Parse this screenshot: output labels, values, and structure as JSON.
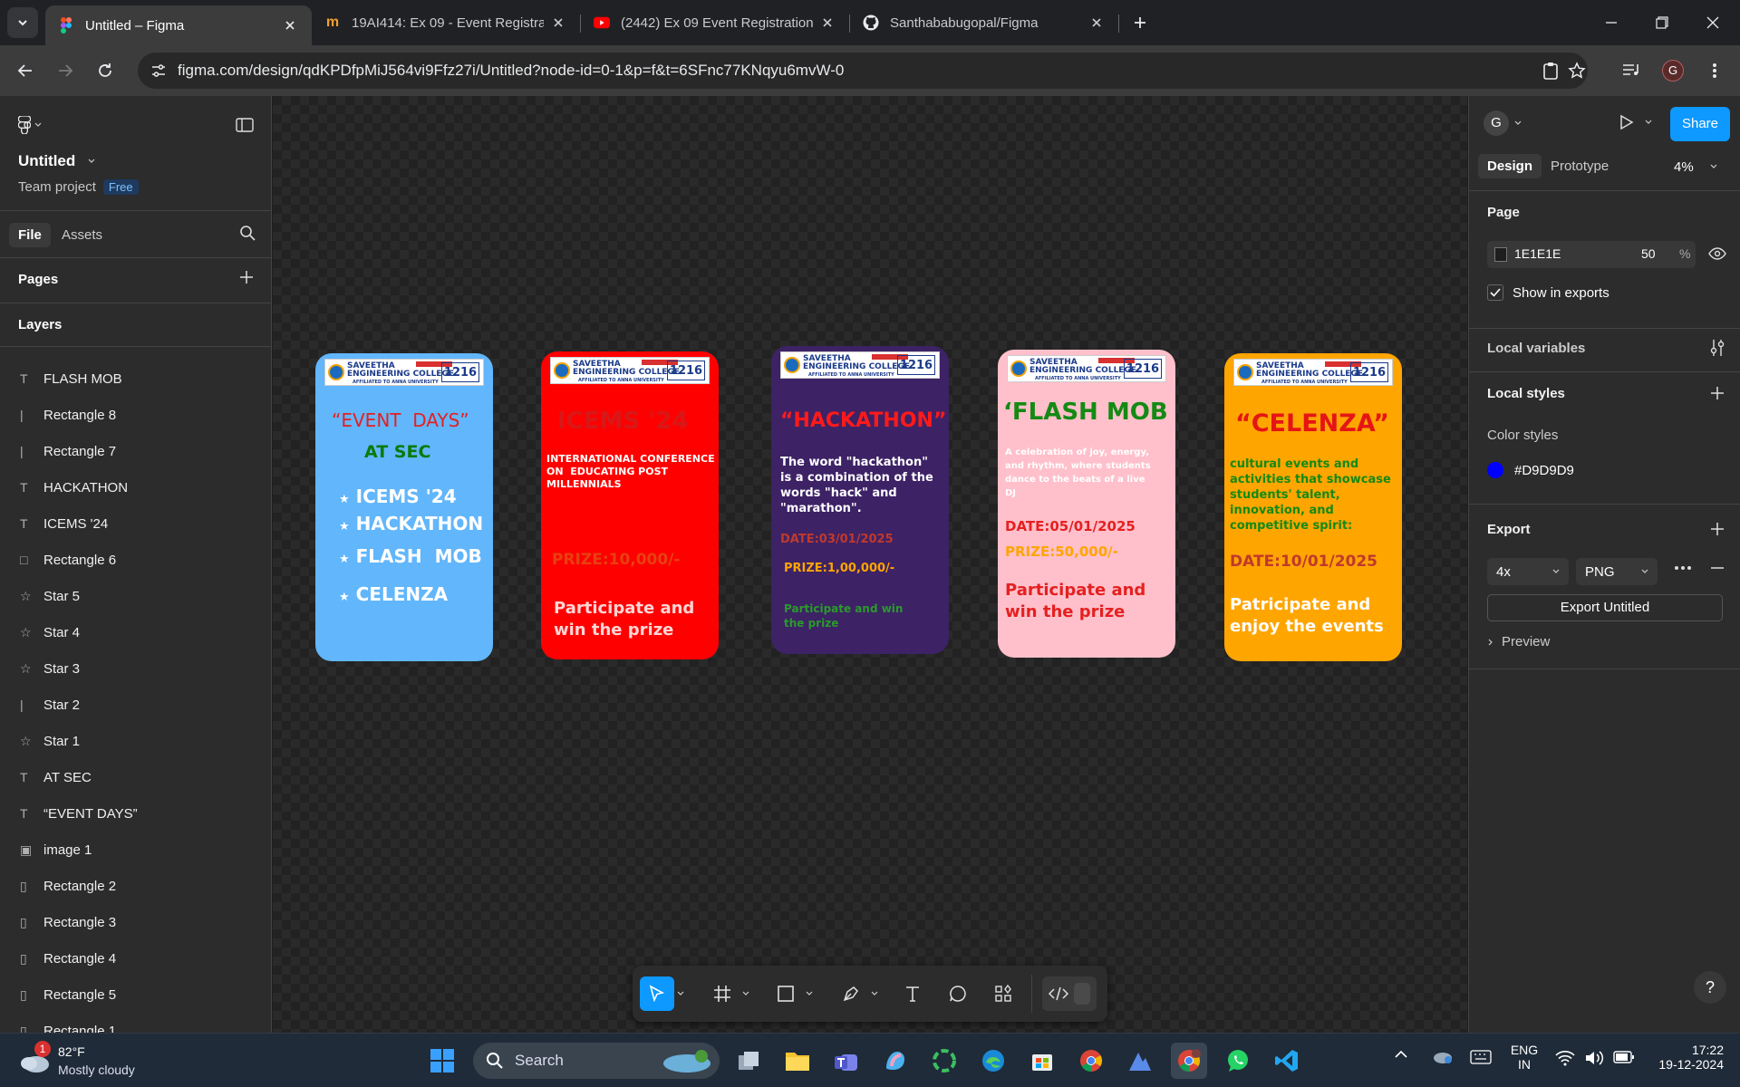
{
  "browser": {
    "tabs": [
      {
        "title": "Untitled – Figma",
        "active": true
      },
      {
        "title": "19AI414: Ex 09 - Event Registrat",
        "active": false
      },
      {
        "title": "(2442) Ex 09 Event Registration",
        "active": false
      },
      {
        "title": "Santhababugopal/Figma",
        "active": false
      }
    ],
    "url": "figma.com/design/qdKPDfpMiJ564vi9Ffz27i/Untitled?node-id=0-1&p=f&t=6SFnc77KNqyu6mvW-0",
    "profile_initial": "G"
  },
  "left_panel": {
    "file_name": "Untitled",
    "team_label": "Team project",
    "plan_badge": "Free",
    "tabs": {
      "file": "File",
      "assets": "Assets"
    },
    "pages_label": "Pages",
    "layers_label": "Layers",
    "layers": [
      {
        "icon": "T",
        "name": "FLASH MOB"
      },
      {
        "icon": "|",
        "name": "Rectangle 8"
      },
      {
        "icon": "|",
        "name": "Rectangle 7"
      },
      {
        "icon": "T",
        "name": "HACKATHON"
      },
      {
        "icon": "T",
        "name": "ICEMS '24"
      },
      {
        "icon": "□",
        "name": "Rectangle 6"
      },
      {
        "icon": "☆",
        "name": "Star 5"
      },
      {
        "icon": "☆",
        "name": "Star 4"
      },
      {
        "icon": "☆",
        "name": "Star 3"
      },
      {
        "icon": "|",
        "name": "Star 2"
      },
      {
        "icon": "☆",
        "name": "Star 1"
      },
      {
        "icon": "T",
        "name": "AT SEC"
      },
      {
        "icon": "T",
        "name": "“EVENT DAYS”"
      },
      {
        "icon": "▣",
        "name": "image 1"
      },
      {
        "icon": "▯",
        "name": "Rectangle 2"
      },
      {
        "icon": "▯",
        "name": "Rectangle 3"
      },
      {
        "icon": "▯",
        "name": "Rectangle 4"
      },
      {
        "icon": "▯",
        "name": "Rectangle 5"
      },
      {
        "icon": "▯",
        "name": "Rectangle 1"
      }
    ]
  },
  "logo": {
    "name": "SAVEETHA\nENGINEERING COLLEGE",
    "affiliation": "AFFILIATED TO ANNA UNIVERSITY",
    "code": "1216"
  },
  "cards": {
    "c1": {
      "title": "“EVENT  DAYS”",
      "subtitle": "AT SEC",
      "items": [
        "ICEMS '24",
        "HACKATHON",
        "FLASH  MOB",
        "CELENZA"
      ]
    },
    "c2": {
      "title": "ICEMS '24",
      "body": "INTERNATIONAL CONFERENCE\nON  EDUCATING POST\nMILLENNIALS",
      "prize": "PRIZE:10,000/-",
      "cta": "Participate and\nwin the prize"
    },
    "c3": {
      "title": "“HACKATHON”",
      "body": "The word \"hackathon\"\nis a combination of the\nwords \"hack\" and\n\"marathon\".",
      "date": "DATE:03/01/2025",
      "prize": "PRIZE:1,00,000/-",
      "cta": "Participate and win\nthe prize"
    },
    "c4": {
      "title": "‘FLASH MOB",
      "body": "A celebration of joy, energy,\nand rhythm, where students\ndance to the beats of a live\nDJ",
      "date": "DATE:05/01/2025",
      "prize": "PRIZE:50,000/-",
      "cta": "Participate and\nwin the prize"
    },
    "c5": {
      "title": "“CELENZA”",
      "body": "cultural events and\nactivities that showcase\nstudents' talent,\ninnovation, and\ncompetitive spirit:",
      "date": "DATE:10/01/2025",
      "cta": "Patricipate and\nenjoy the events"
    }
  },
  "right_panel": {
    "avatar": "G",
    "share_label": "Share",
    "tabs": {
      "design": "Design",
      "prototype": "Prototype"
    },
    "zoom": "4%",
    "page_label": "Page",
    "page_color": "1E1E1E",
    "page_opacity": "50",
    "percent_sign": "%",
    "show_in_exports": "Show in exports",
    "local_variables": "Local variables",
    "local_styles": "Local styles",
    "color_styles": "Color styles",
    "color_style_name": "#D9D9D9",
    "color_style_swatch": "#0000ff",
    "export_label": "Export",
    "export_scale": "4x",
    "export_format": "PNG",
    "export_button": "Export Untitled",
    "preview_label": "Preview",
    "help": "?"
  },
  "taskbar": {
    "weather_temp": "82°F",
    "weather_desc": "Mostly cloudy",
    "weather_badge": "1",
    "search_placeholder": "Search",
    "lang_1": "ENG",
    "lang_2": "IN",
    "time": "17:22",
    "date": "19-12-2024"
  },
  "colors": {
    "card1": "#62b6fb",
    "card2": "#ff0000",
    "card3": "#3d2266",
    "card4": "#ffc0cb",
    "card5": "#ffa500",
    "share": "#0d99ff"
  }
}
